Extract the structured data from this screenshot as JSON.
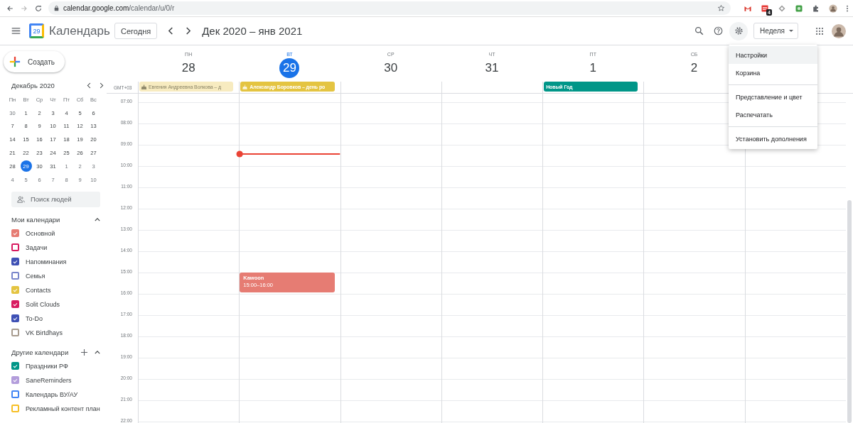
{
  "browser": {
    "url_host": "calendar.google.com",
    "url_path": "/calendar/u/0/r",
    "extension_badge": "4"
  },
  "app_bar": {
    "logo_day": "29",
    "title": "Календарь",
    "today_button": "Сегодня",
    "range": "Дек 2020 – янв 2021",
    "view": "Неделя",
    "settings_open": true
  },
  "create_button": "Создать",
  "mini_calendar": {
    "month": "Декабрь 2020",
    "weekdays": [
      "Пн",
      "Вт",
      "Ср",
      "Чт",
      "Пт",
      "Сб",
      "Вс"
    ],
    "weeks": [
      [
        {
          "d": "30",
          "in_month": false,
          "selected": false
        },
        {
          "d": "1",
          "in_month": true,
          "selected": false
        },
        {
          "d": "2",
          "in_month": true,
          "selected": false
        },
        {
          "d": "3",
          "in_month": true,
          "selected": false
        },
        {
          "d": "4",
          "in_month": true,
          "selected": false
        },
        {
          "d": "5",
          "in_month": true,
          "selected": false
        },
        {
          "d": "6",
          "in_month": true,
          "selected": false
        }
      ],
      [
        {
          "d": "7",
          "in_month": true,
          "selected": false
        },
        {
          "d": "8",
          "in_month": true,
          "selected": false
        },
        {
          "d": "9",
          "in_month": true,
          "selected": false
        },
        {
          "d": "10",
          "in_month": true,
          "selected": false
        },
        {
          "d": "11",
          "in_month": true,
          "selected": false
        },
        {
          "d": "12",
          "in_month": true,
          "selected": false
        },
        {
          "d": "13",
          "in_month": true,
          "selected": false
        }
      ],
      [
        {
          "d": "14",
          "in_month": true,
          "selected": false
        },
        {
          "d": "15",
          "in_month": true,
          "selected": false
        },
        {
          "d": "16",
          "in_month": true,
          "selected": false
        },
        {
          "d": "17",
          "in_month": true,
          "selected": false
        },
        {
          "d": "18",
          "in_month": true,
          "selected": false
        },
        {
          "d": "19",
          "in_month": true,
          "selected": false
        },
        {
          "d": "20",
          "in_month": true,
          "selected": false
        }
      ],
      [
        {
          "d": "21",
          "in_month": true,
          "selected": false
        },
        {
          "d": "22",
          "in_month": true,
          "selected": false
        },
        {
          "d": "23",
          "in_month": true,
          "selected": false
        },
        {
          "d": "24",
          "in_month": true,
          "selected": false
        },
        {
          "d": "25",
          "in_month": true,
          "selected": false
        },
        {
          "d": "26",
          "in_month": true,
          "selected": false
        },
        {
          "d": "27",
          "in_month": true,
          "selected": false
        }
      ],
      [
        {
          "d": "28",
          "in_month": true,
          "selected": false
        },
        {
          "d": "29",
          "in_month": true,
          "selected": true
        },
        {
          "d": "30",
          "in_month": true,
          "selected": false
        },
        {
          "d": "31",
          "in_month": true,
          "selected": false
        },
        {
          "d": "1",
          "in_month": false,
          "selected": false
        },
        {
          "d": "2",
          "in_month": false,
          "selected": false
        },
        {
          "d": "3",
          "in_month": false,
          "selected": false
        }
      ],
      [
        {
          "d": "4",
          "in_month": false,
          "selected": false
        },
        {
          "d": "5",
          "in_month": false,
          "selected": false
        },
        {
          "d": "6",
          "in_month": false,
          "selected": false
        },
        {
          "d": "7",
          "in_month": false,
          "selected": false
        },
        {
          "d": "8",
          "in_month": false,
          "selected": false
        },
        {
          "d": "9",
          "in_month": false,
          "selected": false
        },
        {
          "d": "10",
          "in_month": false,
          "selected": false
        }
      ]
    ]
  },
  "people_search": {
    "placeholder": "Поиск людей"
  },
  "calendar_groups": [
    {
      "title": "Мои календари",
      "expanded": true,
      "items": [
        {
          "name": "Основной",
          "checked": true,
          "color": "#e67c73"
        },
        {
          "name": "Задачи",
          "checked": false,
          "color": "#d81b60"
        },
        {
          "name": "Напоминания",
          "checked": true,
          "color": "#3f51b5"
        },
        {
          "name": "Семья",
          "checked": false,
          "color": "#7986cb"
        },
        {
          "name": "Contacts",
          "checked": true,
          "color": "#e4c441"
        },
        {
          "name": "Solit Clouds",
          "checked": true,
          "color": "#d81b60"
        },
        {
          "name": "To-Do",
          "checked": true,
          "color": "#3f51b5"
        },
        {
          "name": "VK Birtdhays",
          "checked": false,
          "color": "#a79b8e"
        }
      ]
    },
    {
      "title": "Другие календари",
      "expanded": true,
      "can_add": true,
      "items": [
        {
          "name": "Праздники РФ",
          "checked": true,
          "color": "#009688"
        },
        {
          "name": "SaneReminders",
          "checked": true,
          "color": "#b39ddb"
        },
        {
          "name": "Календарь ВУ/АУ",
          "checked": false,
          "color": "#4285f4"
        },
        {
          "name": "Рекламный контент план",
          "checked": false,
          "color": "#f6bf26"
        }
      ]
    }
  ],
  "timezone": "GMT+03",
  "days": [
    {
      "name": "ПН",
      "date": "28",
      "selected": false,
      "all_day": [
        {
          "kind": "birthday",
          "title": "Евгения Андреевна Волкова – д",
          "past": true,
          "color": "#f7ebc0"
        }
      ]
    },
    {
      "name": "ВТ",
      "date": "29",
      "selected": true,
      "all_day": [
        {
          "kind": "birthday",
          "title": "Александр Боровков – день ро",
          "past": false,
          "color": "#e4c441"
        }
      ],
      "events": [
        {
          "title": "Kawoon",
          "time": "15:00–16:00",
          "color": "#e67c73"
        }
      ]
    },
    {
      "name": "СР",
      "date": "30",
      "selected": false
    },
    {
      "name": "ЧТ",
      "date": "31",
      "selected": false
    },
    {
      "name": "ПТ",
      "date": "1",
      "selected": false,
      "all_day": [
        {
          "kind": "holiday",
          "title": "Новый Год",
          "past": false,
          "color": "#009688"
        }
      ]
    },
    {
      "name": "СБ",
      "date": "2",
      "selected": false
    }
  ],
  "hours": [
    "07:00",
    "08:00",
    "09:00",
    "10:00",
    "11:00",
    "12:00",
    "13:00",
    "14:00",
    "15:00",
    "16:00",
    "17:00",
    "18:00",
    "19:00",
    "20:00",
    "21:00",
    "22:00"
  ],
  "settings_menu": [
    [
      {
        "label": "Настройки",
        "highlighted": true
      },
      {
        "label": "Корзина",
        "highlighted": false
      }
    ],
    [
      {
        "label": "Представление и цвет",
        "highlighted": false
      },
      {
        "label": "Распечатать",
        "highlighted": false
      }
    ],
    [
      {
        "label": "Установить дополнения",
        "highlighted": false
      }
    ]
  ]
}
